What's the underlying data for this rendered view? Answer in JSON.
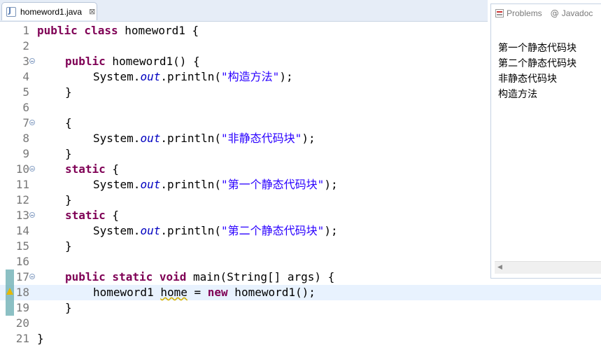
{
  "editor_tab": {
    "filename": "homeword1.java",
    "close": "⊠"
  },
  "side_view": {
    "tabs": [
      {
        "label": "Problems"
      },
      {
        "label": "Javadoc"
      }
    ],
    "console_lines": [
      "第一个静态代码块",
      "第二个静态代码块",
      "非静态代码块",
      "构造方法"
    ]
  },
  "code": {
    "line_numbers": [
      "1",
      "2",
      "3",
      "4",
      "5",
      "6",
      "7",
      "8",
      "9",
      "10",
      "11",
      "12",
      "13",
      "14",
      "15",
      "16",
      "17",
      "18",
      "19",
      "20",
      "21"
    ],
    "l1": {
      "kw": "public class",
      "rest": " homeword1 {"
    },
    "l3": {
      "kw": "public",
      "rest": " homeword1() {"
    },
    "l4": {
      "a": "System.",
      "f": "out",
      "b": ".println(",
      "s": "\"构造方法\"",
      "c": ");"
    },
    "l7": {
      "text": "{"
    },
    "l8": {
      "a": "System.",
      "f": "out",
      "b": ".println(",
      "s": "\"非静态代码块\"",
      "c": ");"
    },
    "l9": {
      "text": "}"
    },
    "l10": {
      "kw": "static",
      "rest": " {"
    },
    "l11": {
      "a": "System.",
      "f": "out",
      "b": ".println(",
      "s": "\"第一个静态代码块\"",
      "c": ");"
    },
    "l12": {
      "text": "}"
    },
    "l13": {
      "kw": "static",
      "rest": " {"
    },
    "l14": {
      "a": "System.",
      "f": "out",
      "b": ".println(",
      "s": "\"第二个静态代码块\"",
      "c": ");"
    },
    "l15": {
      "text": "}"
    },
    "l5": {
      "text": "}"
    },
    "l17": {
      "kw": "public static void",
      "rest": " main(String[] args) {"
    },
    "l18": {
      "a": "homeword1 ",
      "warn": "home",
      "b": " = ",
      "kw": "new",
      "c": " homeword1();"
    },
    "l19": {
      "text": "}"
    },
    "l21": {
      "text": "}"
    }
  }
}
